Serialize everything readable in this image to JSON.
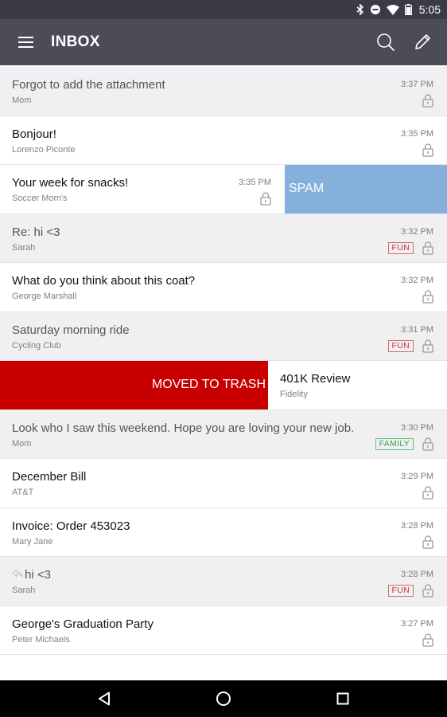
{
  "status": {
    "time": "5:05"
  },
  "app_bar": {
    "title": "INBOX"
  },
  "rows": [
    {
      "subject": "Forgot to add the attachment",
      "sender": "Mom",
      "time": "3:37 PM"
    },
    {
      "subject": "Bonjour!",
      "sender": "Lorenzo Piconte",
      "time": "3:35 PM"
    },
    {
      "subject": "Your week for snacks!",
      "sender": "Soccer Mom's",
      "time": "3:35 PM",
      "action": "SPAM"
    },
    {
      "subject": "Re: hi <3",
      "sender": "Sarah",
      "time": "3:32 PM",
      "tag": "FUN"
    },
    {
      "subject": "What do you think about this coat?",
      "sender": "George Marshall",
      "time": "3:32 PM"
    },
    {
      "subject": "Saturday morning ride",
      "sender": "Cycling Club",
      "time": "3:31 PM",
      "tag": "FUN"
    },
    {
      "subject": "401K Review",
      "sender": "Fidelity",
      "action": "MOVED TO TRASH"
    },
    {
      "subject": "Look who I saw this weekend. Hope you are loving your new job.",
      "sender": "Mom",
      "time": "3:30 PM",
      "tag": "FAMILY"
    },
    {
      "subject": "December Bill",
      "sender": "AT&T",
      "time": "3:29 PM"
    },
    {
      "subject": "Invoice: Order 453023",
      "sender": "Mary Jane",
      "time": "3:28 PM"
    },
    {
      "subject": "hi <3",
      "sender": "Sarah",
      "time": "3:28 PM",
      "tag": "FUN"
    },
    {
      "subject": "George's Graduation Party",
      "sender": "Peter Michaels",
      "time": "3:27 PM"
    }
  ],
  "colors": {
    "app_bar": "#4c4b58",
    "spam": "#86b0dc",
    "trash": "#c90000",
    "fun_tag": "#c0392b",
    "family_tag": "#3aa350"
  }
}
